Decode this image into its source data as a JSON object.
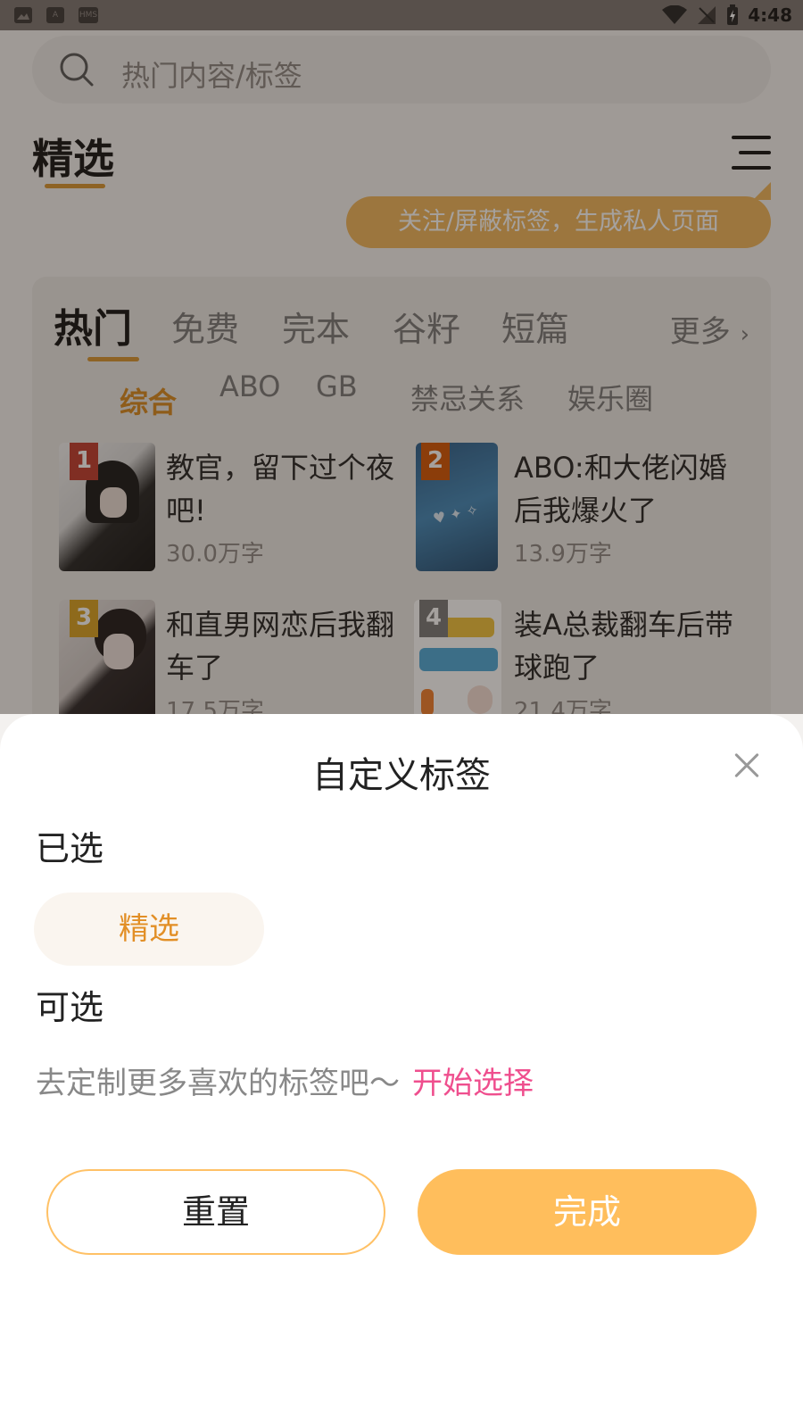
{
  "status_bar": {
    "time": "4:48",
    "left_icons": [
      "image-icon",
      "font-icon",
      "hms-icon"
    ],
    "hms_text": "HMS",
    "font_icon_text": "A"
  },
  "search": {
    "placeholder": "热门内容/标签"
  },
  "header": {
    "section_title": "精选",
    "tip": "关注/屏蔽标签，生成私人页面"
  },
  "tabs": [
    {
      "label": "热门",
      "active": true
    },
    {
      "label": "免费"
    },
    {
      "label": "完本"
    },
    {
      "label": "谷籽"
    },
    {
      "label": "短篇"
    }
  ],
  "more_label": "更多",
  "subtabs": [
    {
      "label": "综合",
      "active": true
    },
    {
      "label": "ABO"
    },
    {
      "label": "GB"
    },
    {
      "label": "禁忌关系"
    },
    {
      "label": "娱乐圈"
    }
  ],
  "books": [
    {
      "rank": "1",
      "title": "教官，留下过个夜吧!",
      "count": "30.0万字",
      "rank_color": "#c0392b"
    },
    {
      "rank": "2",
      "title": "ABO:和大佬闪婚后我爆火了",
      "count": "13.9万字",
      "rank_color": "#d35400"
    },
    {
      "rank": "3",
      "title": "和直男网恋后我翻车了",
      "count": "17.5万字",
      "rank_color": "#d8a020"
    },
    {
      "rank": "4",
      "title": "装A总裁翻车后带球跑了",
      "count": "21.4万字",
      "rank_color": "#777777"
    }
  ],
  "sheet": {
    "title": "自定义标签",
    "selected_label": "已选",
    "selected_tags": [
      "精选"
    ],
    "available_label": "可选",
    "hint": "去定制更多喜欢的标签吧～",
    "hint_link": "开始选择",
    "reset_label": "重置",
    "done_label": "完成"
  },
  "colors": {
    "accent": "#ffbe5c",
    "accent_text": "#e28f26",
    "link": "#ef4f8e"
  }
}
